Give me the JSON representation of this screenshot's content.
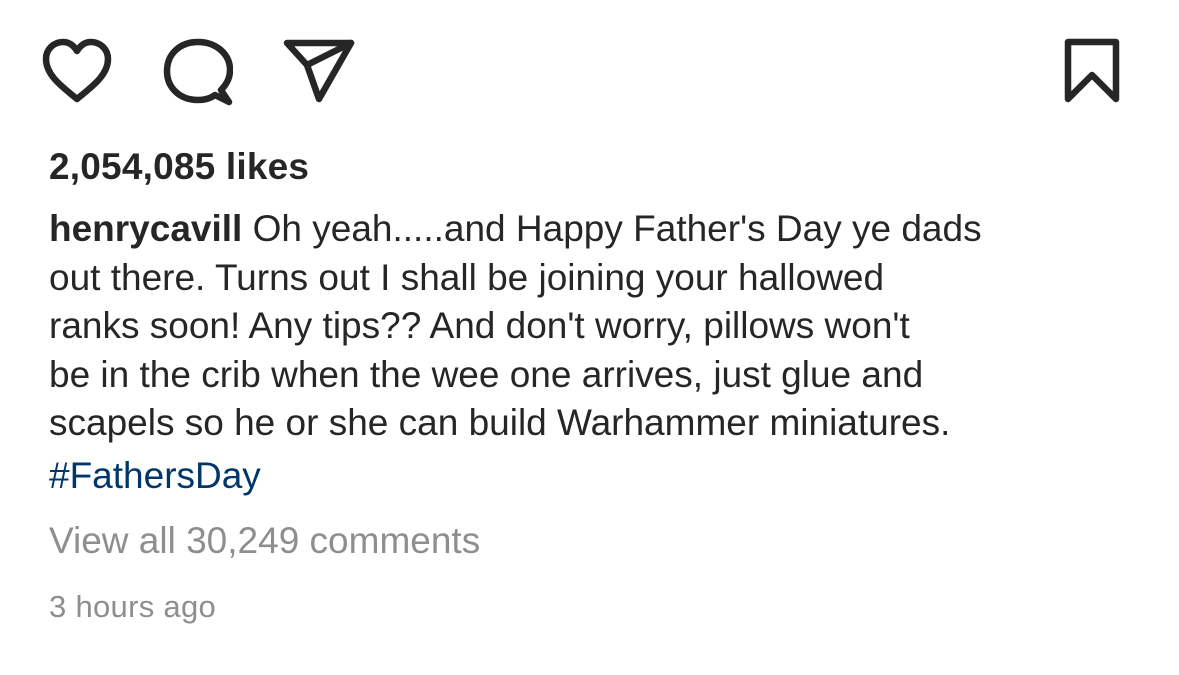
{
  "actions": {
    "like_icon": "heart-icon",
    "comment_icon": "speech-bubble-icon",
    "share_icon": "paper-plane-icon",
    "save_icon": "bookmark-icon"
  },
  "post": {
    "likes": "2,054,085 likes",
    "username": "henrycavill",
    "caption_lines": [
      " Oh yeah.....and Happy Father's Day ye dads",
      "out there. Turns out I shall be joining your hallowed",
      "ranks soon! Any tips?? And don't worry, pillows won't",
      "be in the crib when the wee one arrives, just glue and",
      "scapels so he or she can build Warhammer miniatures."
    ],
    "hashtag": "#FathersDay",
    "view_comments": "View all 30,249 comments",
    "timestamp": "3 hours ago"
  },
  "colors": {
    "text": "#262626",
    "secondary_text": "#8e8e8e",
    "link": "#00376b",
    "background": "#ffffff"
  }
}
